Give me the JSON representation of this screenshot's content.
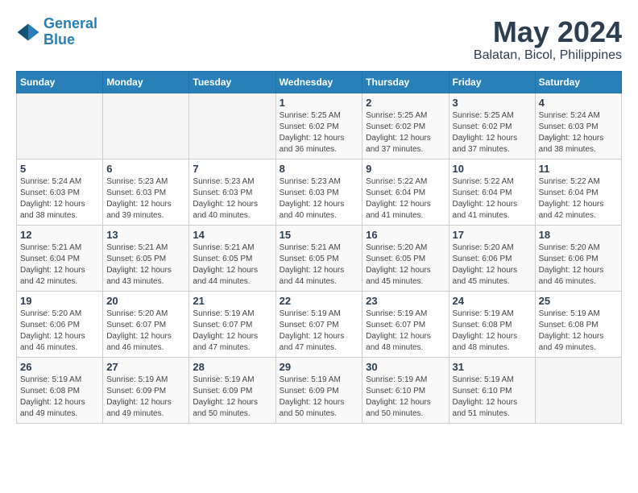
{
  "logo": {
    "line1": "General",
    "line2": "Blue"
  },
  "title": "May 2024",
  "location": "Balatan, Bicol, Philippines",
  "days_of_week": [
    "Sunday",
    "Monday",
    "Tuesday",
    "Wednesday",
    "Thursday",
    "Friday",
    "Saturday"
  ],
  "weeks": [
    [
      {
        "day": "",
        "info": ""
      },
      {
        "day": "",
        "info": ""
      },
      {
        "day": "",
        "info": ""
      },
      {
        "day": "1",
        "info": "Sunrise: 5:25 AM\nSunset: 6:02 PM\nDaylight: 12 hours\nand 36 minutes."
      },
      {
        "day": "2",
        "info": "Sunrise: 5:25 AM\nSunset: 6:02 PM\nDaylight: 12 hours\nand 37 minutes."
      },
      {
        "day": "3",
        "info": "Sunrise: 5:25 AM\nSunset: 6:02 PM\nDaylight: 12 hours\nand 37 minutes."
      },
      {
        "day": "4",
        "info": "Sunrise: 5:24 AM\nSunset: 6:03 PM\nDaylight: 12 hours\nand 38 minutes."
      }
    ],
    [
      {
        "day": "5",
        "info": "Sunrise: 5:24 AM\nSunset: 6:03 PM\nDaylight: 12 hours\nand 38 minutes."
      },
      {
        "day": "6",
        "info": "Sunrise: 5:23 AM\nSunset: 6:03 PM\nDaylight: 12 hours\nand 39 minutes."
      },
      {
        "day": "7",
        "info": "Sunrise: 5:23 AM\nSunset: 6:03 PM\nDaylight: 12 hours\nand 40 minutes."
      },
      {
        "day": "8",
        "info": "Sunrise: 5:23 AM\nSunset: 6:03 PM\nDaylight: 12 hours\nand 40 minutes."
      },
      {
        "day": "9",
        "info": "Sunrise: 5:22 AM\nSunset: 6:04 PM\nDaylight: 12 hours\nand 41 minutes."
      },
      {
        "day": "10",
        "info": "Sunrise: 5:22 AM\nSunset: 6:04 PM\nDaylight: 12 hours\nand 41 minutes."
      },
      {
        "day": "11",
        "info": "Sunrise: 5:22 AM\nSunset: 6:04 PM\nDaylight: 12 hours\nand 42 minutes."
      }
    ],
    [
      {
        "day": "12",
        "info": "Sunrise: 5:21 AM\nSunset: 6:04 PM\nDaylight: 12 hours\nand 42 minutes."
      },
      {
        "day": "13",
        "info": "Sunrise: 5:21 AM\nSunset: 6:05 PM\nDaylight: 12 hours\nand 43 minutes."
      },
      {
        "day": "14",
        "info": "Sunrise: 5:21 AM\nSunset: 6:05 PM\nDaylight: 12 hours\nand 44 minutes."
      },
      {
        "day": "15",
        "info": "Sunrise: 5:21 AM\nSunset: 6:05 PM\nDaylight: 12 hours\nand 44 minutes."
      },
      {
        "day": "16",
        "info": "Sunrise: 5:20 AM\nSunset: 6:05 PM\nDaylight: 12 hours\nand 45 minutes."
      },
      {
        "day": "17",
        "info": "Sunrise: 5:20 AM\nSunset: 6:06 PM\nDaylight: 12 hours\nand 45 minutes."
      },
      {
        "day": "18",
        "info": "Sunrise: 5:20 AM\nSunset: 6:06 PM\nDaylight: 12 hours\nand 46 minutes."
      }
    ],
    [
      {
        "day": "19",
        "info": "Sunrise: 5:20 AM\nSunset: 6:06 PM\nDaylight: 12 hours\nand 46 minutes."
      },
      {
        "day": "20",
        "info": "Sunrise: 5:20 AM\nSunset: 6:07 PM\nDaylight: 12 hours\nand 46 minutes."
      },
      {
        "day": "21",
        "info": "Sunrise: 5:19 AM\nSunset: 6:07 PM\nDaylight: 12 hours\nand 47 minutes."
      },
      {
        "day": "22",
        "info": "Sunrise: 5:19 AM\nSunset: 6:07 PM\nDaylight: 12 hours\nand 47 minutes."
      },
      {
        "day": "23",
        "info": "Sunrise: 5:19 AM\nSunset: 6:07 PM\nDaylight: 12 hours\nand 48 minutes."
      },
      {
        "day": "24",
        "info": "Sunrise: 5:19 AM\nSunset: 6:08 PM\nDaylight: 12 hours\nand 48 minutes."
      },
      {
        "day": "25",
        "info": "Sunrise: 5:19 AM\nSunset: 6:08 PM\nDaylight: 12 hours\nand 49 minutes."
      }
    ],
    [
      {
        "day": "26",
        "info": "Sunrise: 5:19 AM\nSunset: 6:08 PM\nDaylight: 12 hours\nand 49 minutes."
      },
      {
        "day": "27",
        "info": "Sunrise: 5:19 AM\nSunset: 6:09 PM\nDaylight: 12 hours\nand 49 minutes."
      },
      {
        "day": "28",
        "info": "Sunrise: 5:19 AM\nSunset: 6:09 PM\nDaylight: 12 hours\nand 50 minutes."
      },
      {
        "day": "29",
        "info": "Sunrise: 5:19 AM\nSunset: 6:09 PM\nDaylight: 12 hours\nand 50 minutes."
      },
      {
        "day": "30",
        "info": "Sunrise: 5:19 AM\nSunset: 6:10 PM\nDaylight: 12 hours\nand 50 minutes."
      },
      {
        "day": "31",
        "info": "Sunrise: 5:19 AM\nSunset: 6:10 PM\nDaylight: 12 hours\nand 51 minutes."
      },
      {
        "day": "",
        "info": ""
      }
    ]
  ]
}
